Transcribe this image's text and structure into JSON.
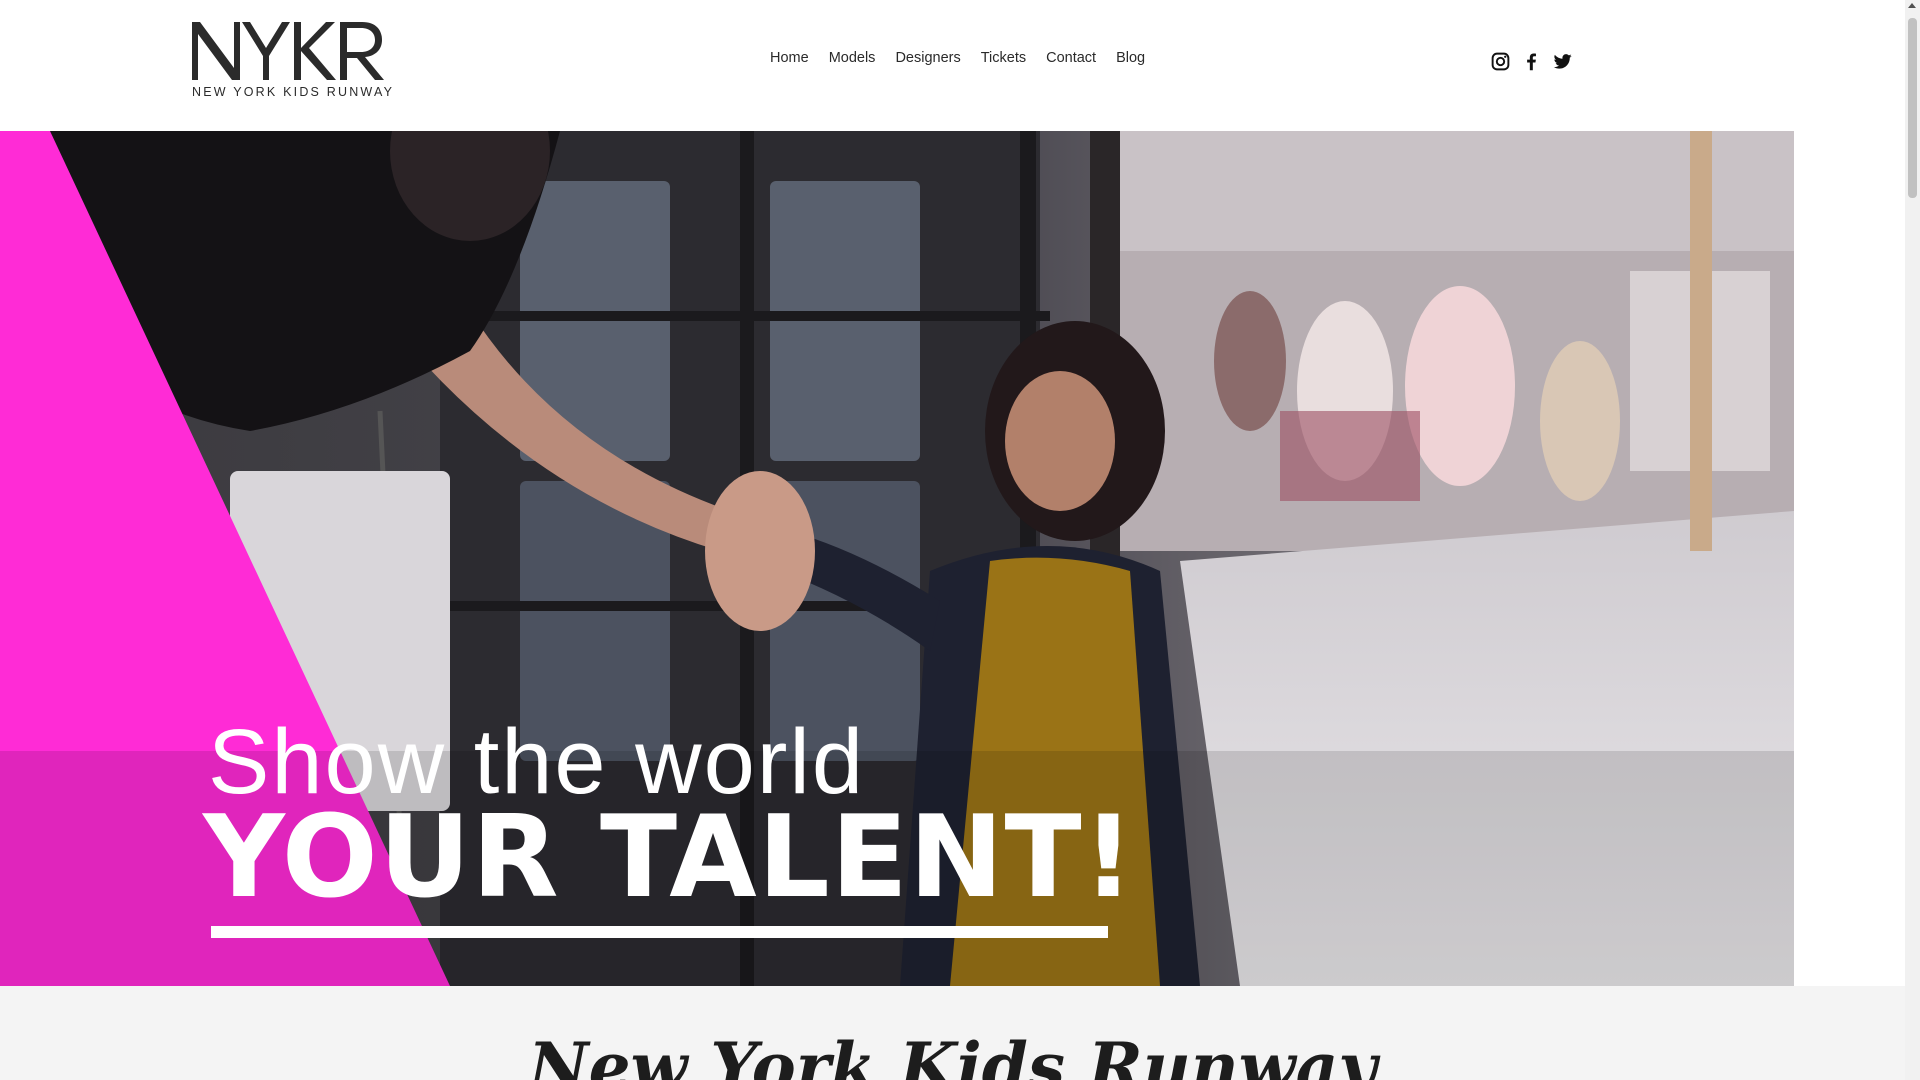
{
  "brand": {
    "logo_letters": "NYKR",
    "name": "NEW YORK KIDS RUNWAY"
  },
  "nav": {
    "items": [
      "Home",
      "Models",
      "Designers",
      "Tickets",
      "Contact",
      "Blog"
    ]
  },
  "social": {
    "icons": [
      "instagram-icon",
      "facebook-icon",
      "twitter-icon"
    ]
  },
  "hero": {
    "line1": "Show the world",
    "line2": "YOUR TALENT!",
    "accent_color": "#ff2bd6"
  },
  "section": {
    "title": "New York Kids Runway"
  }
}
